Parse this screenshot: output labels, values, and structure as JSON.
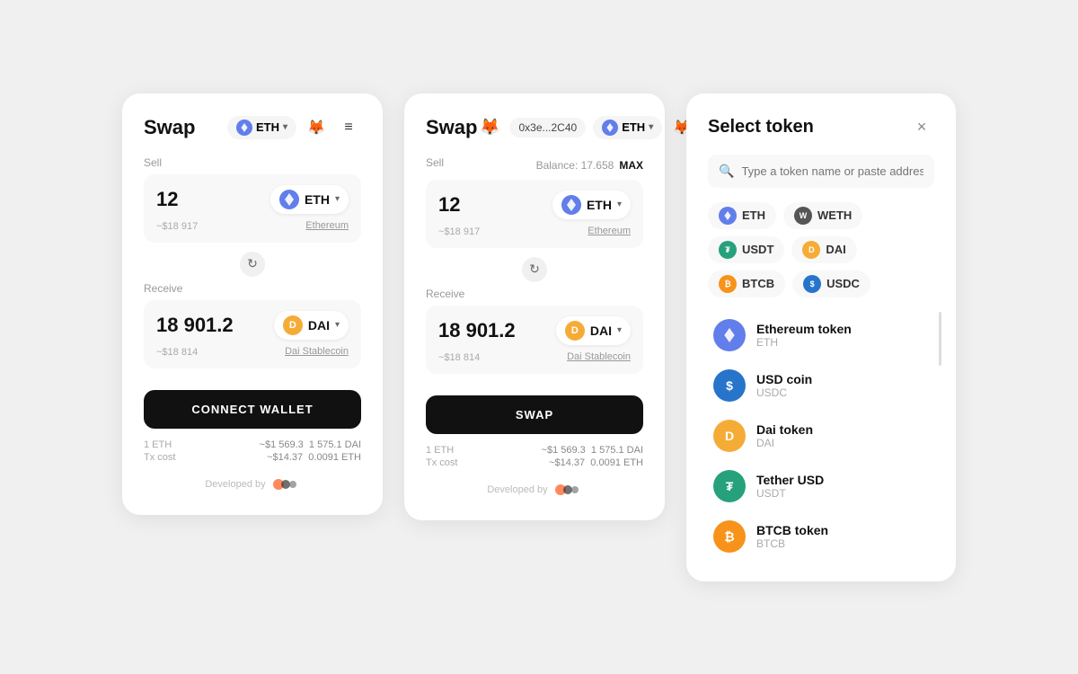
{
  "card1": {
    "title": "Swap",
    "network": "ETH",
    "sell_label": "Sell",
    "receive_label": "Receive",
    "sell_amount": "12",
    "sell_usd": "~$18 917",
    "sell_token": "ETH",
    "sell_token_full": "Ethereum",
    "receive_amount": "18 901.2",
    "receive_usd": "~$18 814",
    "receive_token": "DAI",
    "receive_token_full": "Dai Stablecoin",
    "button_label": "CONNECT WALLET",
    "rate_label": "1 ETH",
    "rate_value": "~$1 569.3",
    "rate_dai": "1 575.1 DAI",
    "tx_label": "Tx cost",
    "tx_usd": "~$14.37",
    "tx_eth": "0.0091 ETH",
    "developed_label": "Developed by"
  },
  "card2": {
    "title": "Swap",
    "network": "ETH",
    "address": "0x3e...2C40",
    "balance_label": "Balance: 17.658",
    "max_label": "MAX",
    "sell_label": "Sell",
    "receive_label": "Receive",
    "sell_amount": "12",
    "sell_usd": "~$18 917",
    "sell_token": "ETH",
    "sell_token_full": "Ethereum",
    "receive_amount": "18 901.2",
    "receive_usd": "~$18 814",
    "receive_token": "DAI",
    "receive_token_full": "Dai Stablecoin",
    "button_label": "SWAP",
    "rate_label": "1 ETH",
    "rate_value": "~$1 569.3",
    "rate_dai": "1 575.1 DAI",
    "tx_label": "Tx cost",
    "tx_usd": "~$14.37",
    "tx_eth": "0.0091 ETH",
    "developed_label": "Developed by"
  },
  "select_token": {
    "title": "Select token",
    "search_placeholder": "Type a token name or paste address",
    "quick_tokens": [
      {
        "symbol": "ETH",
        "color": "#627EEA"
      },
      {
        "symbol": "WETH",
        "color": "#888888"
      },
      {
        "symbol": "USDT",
        "color": "#26A17B"
      },
      {
        "symbol": "DAI",
        "color": "#F5AC37"
      },
      {
        "symbol": "BTCB",
        "color": "#F7931A"
      },
      {
        "symbol": "USDC",
        "color": "#2775CA"
      }
    ],
    "tokens": [
      {
        "name": "Ethereum token",
        "symbol": "ETH",
        "color": "#627EEA"
      },
      {
        "name": "USD coin",
        "symbol": "USDC",
        "color": "#2775CA"
      },
      {
        "name": "Dai token",
        "symbol": "DAI",
        "color": "#F5AC37"
      },
      {
        "name": "Tether USD",
        "symbol": "USDT",
        "color": "#26A17B"
      },
      {
        "name": "BTCB token",
        "symbol": "BTCB",
        "color": "#F7931A"
      }
    ]
  }
}
